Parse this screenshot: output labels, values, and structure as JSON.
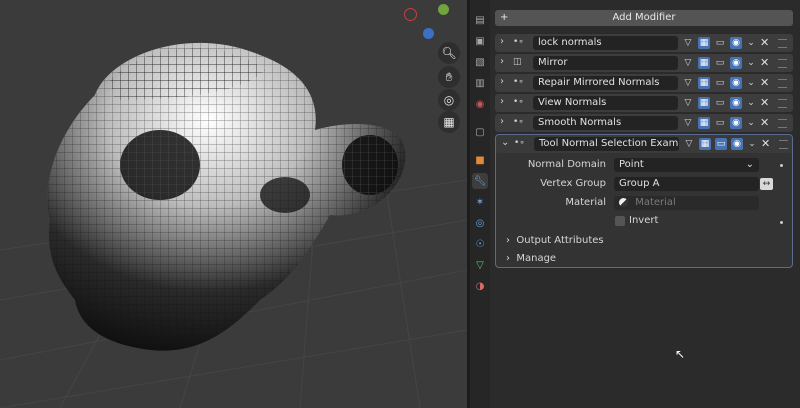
{
  "viewport": {
    "gizmo_colors": {
      "x": "#c73e3e",
      "y": "#71a33e",
      "z": "#3e6fc7"
    },
    "nav_icons": [
      "zoom-icon",
      "hand-pan-icon",
      "camera-icon",
      "grid-perspective-icon"
    ]
  },
  "tabs": [
    "tool",
    "render",
    "output",
    "view-layer",
    "scene",
    "world",
    "collection",
    "object",
    "modifiers",
    "particles",
    "physics",
    "constraints",
    "data",
    "material",
    "texture"
  ],
  "modifiers_panel": {
    "add_modifier_label": "Add Modifier",
    "modifiers": [
      {
        "name": "lock normals",
        "icon": "geometry-nodes-icon",
        "expanded": false
      },
      {
        "name": "Mirror",
        "icon": "mirror-icon",
        "expanded": false
      },
      {
        "name": "Repair Mirrored Normals",
        "icon": "geometry-nodes-icon",
        "expanded": false
      },
      {
        "name": "View Normals",
        "icon": "geometry-nodes-icon",
        "expanded": false
      },
      {
        "name": "Smooth Normals",
        "icon": "geometry-nodes-icon",
        "expanded": false
      },
      {
        "name": "Tool Normal Selection Example",
        "icon": "geometry-nodes-icon",
        "expanded": true
      }
    ],
    "expanded": {
      "normal_domain_label": "Normal Domain",
      "normal_domain_value": "Point",
      "vertex_group_label": "Vertex Group",
      "vertex_group_value": "Group A",
      "material_label": "Material",
      "material_placeholder": "Material",
      "invert_label": "Invert",
      "invert_checked": false,
      "output_attributes_label": "Output Attributes",
      "manage_label": "Manage"
    }
  }
}
